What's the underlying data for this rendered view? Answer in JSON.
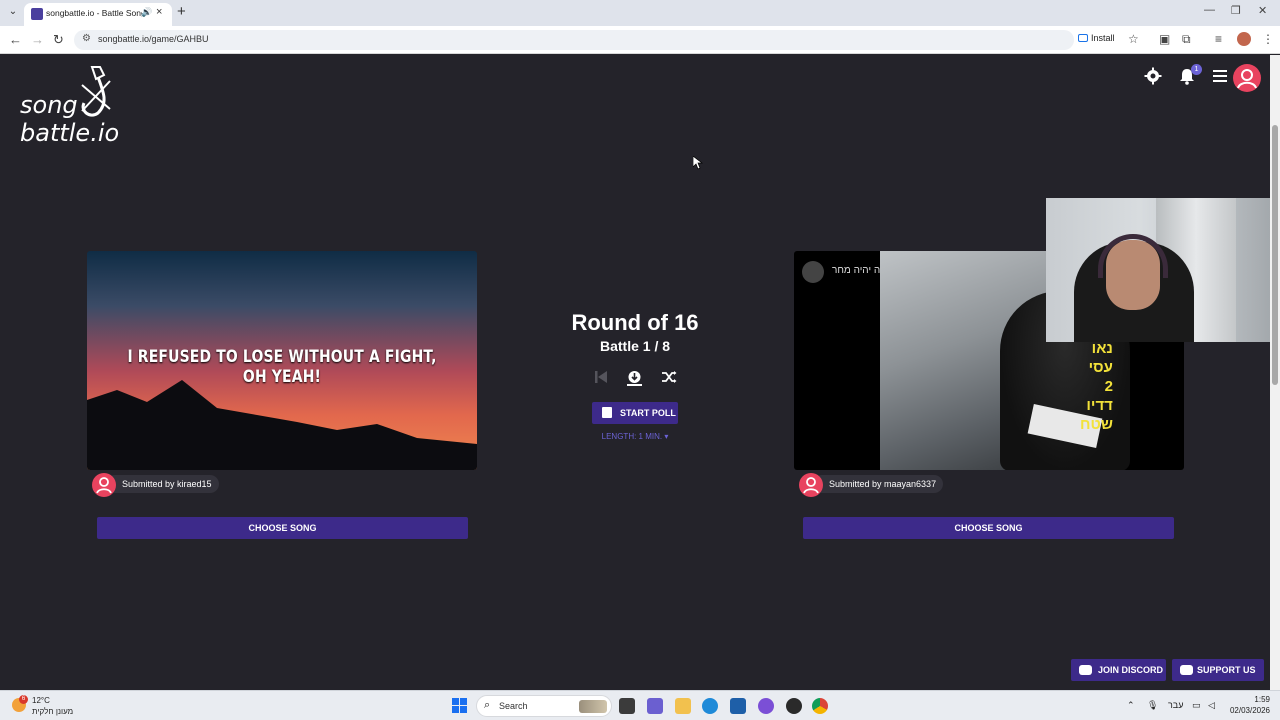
{
  "browser": {
    "tab_title": "songbattle.io - Battle Song",
    "new_tab": "+",
    "url": "songbattle.io/game/GAHBU",
    "install_label": "Install"
  },
  "header": {
    "logo_line1": "song",
    "logo_line2": "battle.io",
    "notification_count": "1"
  },
  "battle": {
    "round_title": "Round of 16",
    "battle_label": "Battle 1 / 8",
    "start_poll_label": "START POLL",
    "length_label": "LENGTH: 1 MIN. ▾"
  },
  "left_song": {
    "lyric": "I REFUSED TO LOSE WITHOUT A FIGHT, OH YEAH!",
    "submitted_by": "Submitted by kiraed15",
    "choose_label": "CHOOSE SONG"
  },
  "right_song": {
    "channel_title": "מה יהיה מחר",
    "overlay_text_line1": "נאו עסי",
    "overlay_text_line2": "2 דדיו שטח",
    "submitted_by": "Submitted by maayan6337",
    "choose_label": "CHOOSE SONG"
  },
  "footer_buttons": {
    "discord_label": "JOIN DISCORD",
    "support_label": "SUPPORT US"
  },
  "taskbar": {
    "temperature": "12°C",
    "weather_text": "מעונן חלקית",
    "weather_alert": "6",
    "search_label": "Search",
    "language": "עבר",
    "time": "1:59",
    "date": "02/03/2026"
  },
  "colors": {
    "page_bg": "#24232a",
    "accent_purple": "#3d2a8a",
    "accent_pink": "#e8435f",
    "link_purple": "#6c63d6"
  },
  "icons": [
    "settings-gear-icon",
    "notification-bell-icon",
    "hamburger-menu-icon",
    "user-avatar-icon",
    "previous-icon",
    "download-icon",
    "shuffle-icon",
    "poll-icon",
    "discord-icon",
    "support-icon"
  ]
}
